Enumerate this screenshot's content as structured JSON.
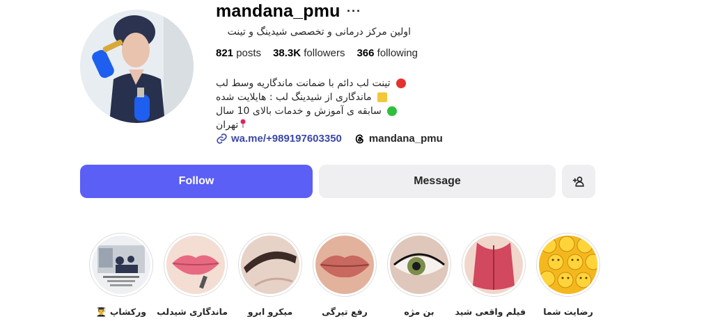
{
  "profile": {
    "username": "mandana_pmu",
    "more_label": "···",
    "full_name": "اولین مرکز درمانی و تخصصی شیدینگ و تینت",
    "stats": {
      "posts_count": "821",
      "posts_label": "posts",
      "followers_count": "38.3K",
      "followers_label": "followers",
      "following_count": "366",
      "following_label": "following"
    },
    "bio": [
      "تینت لب دائم با ضمانت ماندگاریه وسط لب",
      "ماندگاری از شیدینگ لب : هایلایت شده",
      "سابقه ی آموزش و خدمات بالای 10 سال",
      "تهران"
    ],
    "bio_icons": [
      "red-circle",
      "yellow-square",
      "green-circle",
      "pin"
    ],
    "bio_colors": {
      "red": "#e5322e",
      "yellow": "#f3c73a",
      "green": "#2fbf3c",
      "pin": "#e0245e"
    },
    "link_text": "wa.me/+989197603350",
    "threads_handle": "mandana_pmu"
  },
  "actions": {
    "follow_label": "Follow",
    "message_label": "Message"
  },
  "colors": {
    "follow_bg": "#5b5ff5",
    "secondary_bg": "#efeff1",
    "link": "#3a48a8"
  },
  "highlights": [
    {
      "label": "ورکشاپ 👨‍🎓",
      "icon": "workshop-photo"
    },
    {
      "label": "ماندگاری شیدلب",
      "icon": "lips-photo"
    },
    {
      "label": "میکرو ابرو",
      "icon": "eyebrow-photo"
    },
    {
      "label": "رفع تیرگی",
      "icon": "lips-photo"
    },
    {
      "label": "بن مژه",
      "icon": "eye-photo"
    },
    {
      "label": "فیلم واقعی شید",
      "icon": "lips-photo"
    },
    {
      "label": "رضایت شما",
      "icon": "emoji-photo"
    }
  ]
}
